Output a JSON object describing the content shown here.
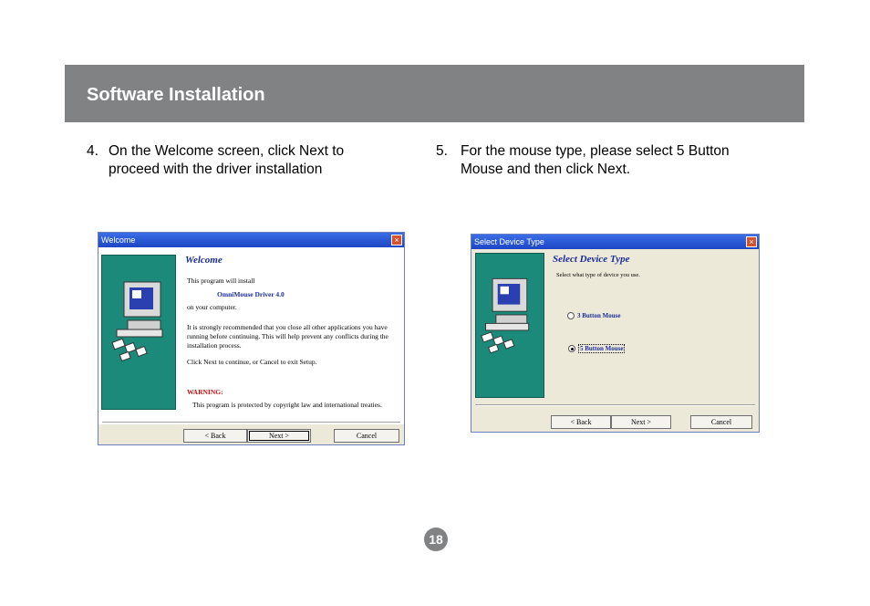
{
  "header": {
    "title": "Software Installation"
  },
  "steps": [
    {
      "number": "4.",
      "text": "On the Welcome screen, click Next to proceed with the driver installation"
    },
    {
      "number": "5.",
      "text": "For the mouse type, please select 5 Button Mouse and then click Next."
    }
  ],
  "welcome_dialog": {
    "title": "Welcome",
    "close_glyph": "×",
    "heading": "Welcome",
    "line1": "This program will install",
    "product": "OmniMouse Driver 4.0",
    "line2": "on your computer.",
    "recommend": "It is strongly recommended that you close all other applications you have running before continuing. This will help prevent any conflicts during the installation process.",
    "click_next": "Click Next to continue, or Cancel to exit Setup.",
    "warning_label": "WARNING:",
    "warning_text": "This program is protected by copyright law and international treaties.",
    "buttons": {
      "back": "< Back",
      "next": "Next >",
      "cancel": "Cancel"
    }
  },
  "device_dialog": {
    "title": "Select Device Type",
    "close_glyph": "×",
    "heading": "Select Device Type",
    "prompt": "Select what type of device you use.",
    "options": [
      {
        "label": "3 Button Mouse",
        "selected": false
      },
      {
        "label": "5 Button Mouse",
        "selected": true
      }
    ],
    "buttons": {
      "back": "< Back",
      "next": "Next >",
      "cancel": "Cancel"
    }
  },
  "page": {
    "number": "18"
  },
  "colors": {
    "header_bg": "#808284",
    "teal_panel": "#1c8a7a",
    "titlebar": "#1d45c4",
    "heading_blue": "#1a2d9c"
  }
}
